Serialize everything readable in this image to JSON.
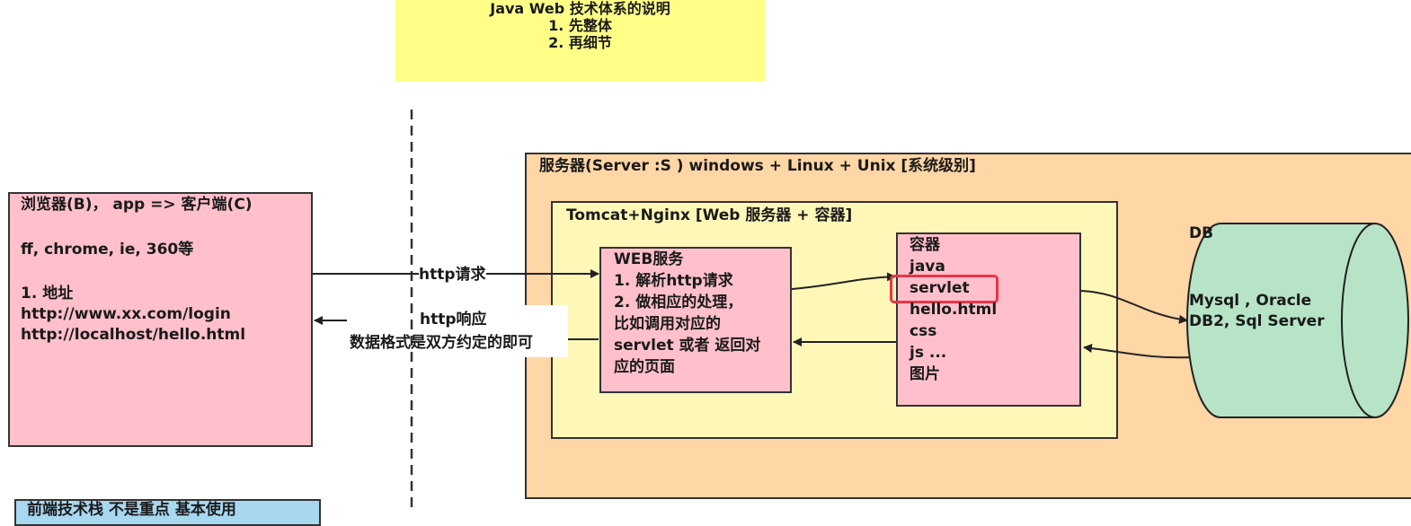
{
  "note": {
    "title": "Java Web 技术体系的说明",
    "item1": "1. 先整体",
    "item2": "2. 再细节"
  },
  "client": {
    "title": "浏览器(B)， app => 客户端(C)",
    "browsers": "ff, chrome, ie, 360等",
    "address_heading": "1. 地址",
    "url1": "http://www.xx.com/login",
    "url2": "http://localhost/hello.html"
  },
  "frontend": {
    "label": "前端技术栈 不是重点 基本使用"
  },
  "arrows": {
    "request": "http请求",
    "response": "http响应",
    "response_note": "数据格式是双方约定的即可"
  },
  "server": {
    "title": "服务器(Server :S ) windows + Linux + Unix [系统级别]"
  },
  "tomcat": {
    "title": "Tomcat+Nginx [Web 服务器 + 容器]"
  },
  "web_service": {
    "title": "WEB服务",
    "step1": "1. 解析http请求",
    "step2": "2. 做相应的处理，",
    "step2_cont1": "比如调用对应的",
    "step2_cont2": "servlet 或者 返回对",
    "step2_cont3": "应的页面"
  },
  "container": {
    "title": "容器",
    "items": [
      "java",
      "servlet",
      "hello.html",
      "css",
      "js ...",
      "图片"
    ]
  },
  "db": {
    "label": "DB",
    "line1": "Mysql , Oracle",
    "line2": "DB2, Sql Server"
  },
  "colors": {
    "note": "#ffff88",
    "client": "#ffc0cb",
    "server": "#ffd6a5",
    "tomcat": "#fff7b8",
    "db": "#b7e4c7",
    "frontend": "#a8d8f0",
    "highlight": "#ee3344"
  }
}
